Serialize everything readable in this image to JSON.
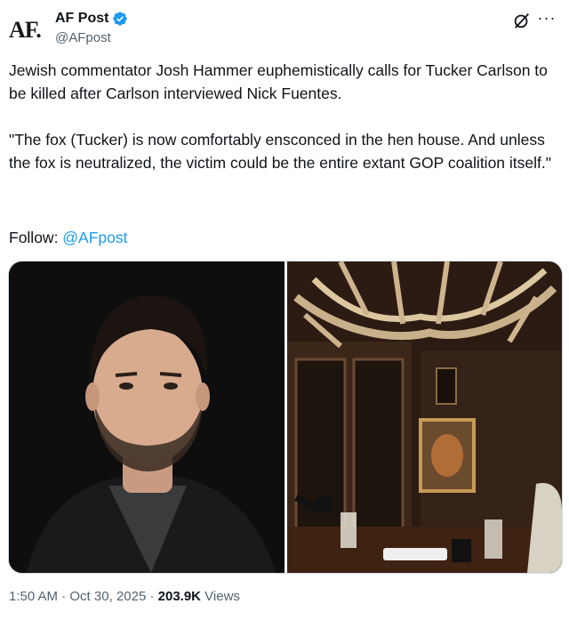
{
  "author": {
    "logo": "AF.",
    "name": "AF Post",
    "handle": "@AFpost",
    "verified_color": "#1d9bf0"
  },
  "post": {
    "text": "Jewish commentator Josh Hammer euphemistically calls for Tucker Carlson to be killed after Carlson interviewed Nick Fuentes.\n\n\"The fox (Tucker) is now comfortably ensconced in the hen house. And unless the fox is neutralized, the victim could be the entire extant GOP coalition itself.\"",
    "follow_label": "Follow: ",
    "follow_mention": "@AFpost"
  },
  "media": {
    "icons": [
      "portrait-photo",
      "studio-photo"
    ]
  },
  "meta": {
    "time": "1:50 AM",
    "sep1": " · ",
    "date": "Oct 30, 2025",
    "sep2": " · ",
    "views_count": "203.9K",
    "views_label": " Views"
  },
  "icons": {
    "grok": "grok-icon",
    "more": "more-icon",
    "verified": "verified-badge-icon"
  }
}
